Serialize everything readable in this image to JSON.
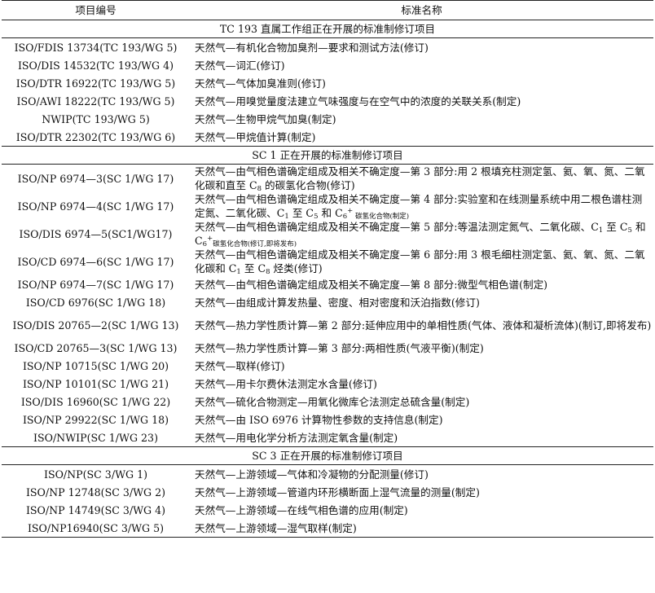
{
  "header": {
    "col_code": "项目编号",
    "col_name": "标准名称"
  },
  "sections": [
    {
      "title": "TC 193 直属工作组正在开展的标准制修订项目",
      "rows": [
        {
          "code": "ISO/FDIS 13734(TC 193/WG 5)",
          "name": "天然气—有机化合物加臭剂—要求和测试方法(修订)"
        },
        {
          "code": "ISO/DIS 14532(TC 193/WG 4)",
          "name": "天然气—词汇(修订)"
        },
        {
          "code": "ISO/DTR 16922(TC 193/WG 5)",
          "name": "天然气—气体加臭准则(修订)"
        },
        {
          "code": "ISO/AWI 18222(TC 193/WG 5)",
          "name": "天然气—用嗅觉量度法建立气味强度与在空气中的浓度的关联关系(制定)"
        },
        {
          "code": "NWIP(TC 193/WG 5)",
          "name": "天然气—生物甲烷气加臭(制定)"
        },
        {
          "code": "ISO/DTR 22302(TC 193/WG 6)",
          "name": "天然气—甲烷值计算(制定)"
        }
      ]
    },
    {
      "title": "SC 1 正在开展的标准制修订项目",
      "rows": [
        {
          "code": "ISO/NP 6974—3(SC 1/WG 17)",
          "name_parts": [
            "天然气—由气相色谱确定组成及相关不确定度—第 3 部分:用 2 根填充柱测定氢、氦、氧、氮、二氧化碳和直至 C",
            "8",
            " 的碳氢化合物(修订)"
          ]
        },
        {
          "code": "ISO/NP 6974—4(SC 1/WG 17)",
          "name_parts": [
            "天然气—由气相色谱确定组成及相关不确定度—第 4 部分:实验室和在线测量系统中用二根色谱柱测定氮、二氧化碳、C",
            "1",
            " 至 C",
            "5",
            " 和 C",
            "6",
            "+",
            " 碳氢化合物(制定)"
          ]
        },
        {
          "code": "ISO/DIS 6974—5(SC1/WG17)",
          "name_parts": [
            "天然气—由气相色谱确定组成及相关不确定度—第 5 部分:等温法测定氮气、二氧化碳、C",
            "1",
            " 至 C",
            "5",
            " 和 C",
            "6",
            "+",
            "碳氢化合物(修订,即将发布)"
          ]
        },
        {
          "code": "ISO/CD 6974—6(SC 1/WG 17)",
          "name_parts": [
            "天然气—由气相色谱确定组成及相关不确定度—第 6 部分:用 3 根毛细柱测定氢、氦、氧、氮、二氧化碳和 C",
            "1",
            " 至 C",
            "8",
            " 烃类(修订)"
          ]
        },
        {
          "code": "ISO/NP 6974—7(SC 1/WG 17)",
          "name": "天然气—由气相色谱确定组成及相关不确定度—第 8 部分:微型气相色谱(制定)"
        },
        {
          "code": "ISO/CD 6976(SC 1/WG 18)",
          "name": "天然气—由组成计算发热量、密度、相对密度和沃泊指数(修订)"
        },
        {
          "code": "ISO/DIS 20765—2(SC 1/WG 13)",
          "name": "天然气—热力学性质计算—第 2 部分:延伸应用中的单相性质(气体、液体和凝析流体)(制订,即将发布)"
        },
        {
          "code": "ISO/CD 20765—3(SC 1/WG 13)",
          "name": "天然气—热力学性质计算—第 3 部分:两相性质(气液平衡)(制定)"
        },
        {
          "code": "ISO/NP 10715(SC 1/WG 20)",
          "name": "天然气—取样(修订)"
        },
        {
          "code": "ISO/NP 10101(SC 1/WG 21)",
          "name": "天然气—用卡尔费休法测定水含量(修订)"
        },
        {
          "code": "ISO/DIS 16960(SC 1/WG 22)",
          "name": "天然气—硫化合物测定—用氧化微库仑法测定总硫含量(制定)"
        },
        {
          "code": "ISO/NP 29922(SC 1/WG 18)",
          "name": "天然气—由 ISO 6976 计算物性参数的支持信息(制定)"
        },
        {
          "code": "ISO/NWIP(SC 1/WG 23)",
          "name": "天然气—用电化学分析方法测定氧含量(制定)"
        }
      ]
    },
    {
      "title": "SC 3 正在开展的标准制修订项目",
      "rows": [
        {
          "code": "ISO/NP(SC 3/WG 1)",
          "name": "天然气—上游领域—气体和冷凝物的分配测量(修订)"
        },
        {
          "code": "ISO/NP 12748(SC 3/WG 2)",
          "name": "天然气—上游领域—管道内环形横断面上湿气流量的测量(制定)"
        },
        {
          "code": "ISO/NP 14749(SC 3/WG 4)",
          "name": "天然气—上游领域—在线气相色谱的应用(制定)"
        },
        {
          "code": "ISO/NP16940(SC 3/WG 5)",
          "name": "天然气—上游领域—湿气取样(制定)"
        }
      ]
    }
  ]
}
